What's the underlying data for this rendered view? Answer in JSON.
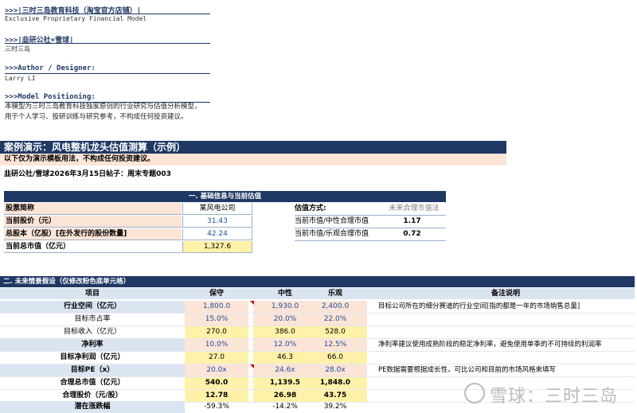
{
  "header": {
    "shop": ">>>|三时三岛教育科技（淘宝官方店铺）|",
    "model_en": "Exclusive Proprietary Financial Model",
    "platform": ">>>|韭研公社+雪球|",
    "platform_name": "三时三岛",
    "author_title": ">>>Author / Designer:",
    "author": "Larry LI",
    "positioning_title": ">>>Model Positioning:",
    "positioning_line1": "本模型为三时三岛教育科技独家原创的行业研究与估值分析模型，",
    "positioning_line2": "用于个人学习、投研训练与研究参考，不构成任何投资建议。"
  },
  "banner": {
    "title": "案例演示：风电整机龙头估值测算（示例）",
    "warning": "以下仅为演示模板用法，不构成任何投资建议。",
    "source": "韭研公社/雪球2026年3月15日帖子：周末专题003"
  },
  "section1": {
    "title": "一. 基础信息与当前估值",
    "rows": [
      {
        "label": "股票简称",
        "value": "某风电公司"
      },
      {
        "label": "当前股价（元）",
        "value": "31.43"
      },
      {
        "label": "总股本（亿股）[在外发行的股份数量]",
        "value": "42.24"
      },
      {
        "label": "当前总市值（亿元）",
        "value": "1,327.6"
      }
    ],
    "valuation": {
      "method_label": "估值方式:",
      "method_value": "未来合理市值法",
      "rows": [
        {
          "label": "当前市值/中性合理市值",
          "value": "1.17"
        },
        {
          "label": "当前市值/乐观合理市值",
          "value": "0.72"
        }
      ]
    }
  },
  "section2": {
    "title": "二. 未来情景假设（仅修改粉色底单元格）",
    "headers": {
      "item": "项目",
      "conservative": "保守",
      "neutral": "中性",
      "optimistic": "乐观",
      "note": "备注说明"
    },
    "rows": [
      {
        "label": "行业空间（亿元）",
        "v1": "1,800.0",
        "v2": "1,930.0",
        "v3": "2,400.0",
        "note": "目标公司所在的细分赛道的行业空间[指的都是一年的市场销售总量]"
      },
      {
        "label": "目标市占率",
        "v1": "15.0%",
        "v2": "20.0%",
        "v3": "22.0%",
        "note": ""
      },
      {
        "label": "目标收入（亿元）",
        "v1": "270.0",
        "v2": "386.0",
        "v3": "528.0",
        "note": ""
      },
      {
        "label": "净利率",
        "v1": "10.0%",
        "v2": "12.0%",
        "v3": "12.5%",
        "note": "净利率建议使用成熟阶段的稳定净利率，避免使用单季的不可持续的利润率"
      },
      {
        "label": "目标净利润（亿元）",
        "v1": "27.0",
        "v2": "46.3",
        "v3": "66.0",
        "note": ""
      },
      {
        "label": "目标PE（x）",
        "v1": "20.0x",
        "v2": "24.6x",
        "v3": "28.0x",
        "note": "PE数据需要根据成长性，可比公司和目前的市场风格来填写"
      },
      {
        "label": "合理总市值（亿元）",
        "v1": "540.0",
        "v2": "1,139.5",
        "v3": "1,848.0",
        "note": ""
      },
      {
        "label": "合理股价（元/股）",
        "v1": "12.78",
        "v2": "26.98",
        "v3": "43.75",
        "note": ""
      },
      {
        "label": "潜在涨跌幅",
        "v1": "-59.3%",
        "v2": "-14.2%",
        "v3": "39.2%",
        "note": ""
      }
    ]
  },
  "watermark": "雪球：三时三岛",
  "colors": {
    "navy": "#1f3864",
    "pink": "#fce4d6",
    "yellow": "#fff2a8",
    "blue_text": "#1f4e9f",
    "comment_marker": "#d00000"
  }
}
